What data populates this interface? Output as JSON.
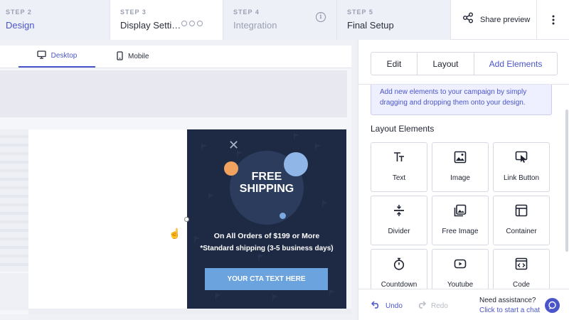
{
  "steps": [
    {
      "num": "STEP 2",
      "title": "Design"
    },
    {
      "num": "STEP 3",
      "title": "Display Settin..."
    },
    {
      "num": "STEP 4",
      "title": "Integration"
    },
    {
      "num": "STEP 5",
      "title": "Final Setup"
    }
  ],
  "header": {
    "share_label": "Share preview"
  },
  "device_tabs": {
    "desktop": "Desktop",
    "mobile": "Mobile"
  },
  "popup": {
    "headline_line1": "FREE",
    "headline_line2": "SHIPPING",
    "offer": "On All Orders of $199 or More",
    "note": "*Standard shipping (3-5 business days)",
    "cta": "YOUR CTA TEXT HERE",
    "colors": {
      "background": "#1e2a44",
      "cta": "#6aa3dd",
      "accent_orange": "#f0a25e"
    }
  },
  "panel": {
    "tabs": [
      "Edit",
      "Layout",
      "Add Elements"
    ],
    "active_tab": "Add Elements",
    "info_text": "Add new elements to your campaign by simply dragging and dropping them onto your design.",
    "section_title": "Layout Elements",
    "elements": [
      {
        "label": "Text",
        "icon": "text-icon"
      },
      {
        "label": "Image",
        "icon": "image-icon"
      },
      {
        "label": "Link Button",
        "icon": "link-button-icon"
      },
      {
        "label": "Divider",
        "icon": "divider-icon"
      },
      {
        "label": "Free Image",
        "icon": "free-image-icon"
      },
      {
        "label": "Container",
        "icon": "container-icon"
      },
      {
        "label": "Countdown",
        "icon": "stopwatch-icon"
      },
      {
        "label": "Youtube",
        "icon": "youtube-icon"
      },
      {
        "label": "Code",
        "icon": "code-icon"
      }
    ],
    "footer": {
      "undo": "Undo",
      "redo": "Redo",
      "assist_title": "Need assistance?",
      "assist_link": "Click to start a chat"
    }
  },
  "accent_color": "#4a55c9"
}
